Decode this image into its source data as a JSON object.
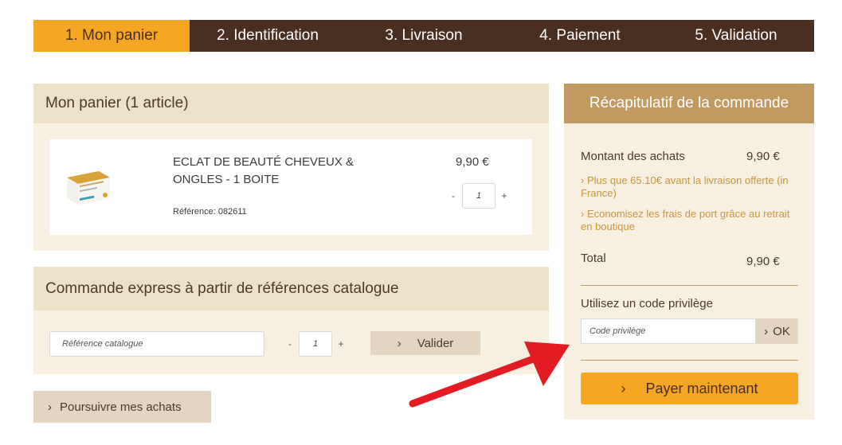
{
  "steps": [
    {
      "label": "1. Mon panier"
    },
    {
      "label": "2. Identification"
    },
    {
      "label": "3. Livraison"
    },
    {
      "label": "4. Paiement"
    },
    {
      "label": "5. Validation"
    }
  ],
  "cart": {
    "title": "Mon panier (1 article)",
    "item": {
      "name": "ECLAT DE BEAUTÉ CHEVEUX & ONGLES - 1 BOITE",
      "reference": "Référence: 082611",
      "price": "9,90 €",
      "quantity": "1",
      "minus": "-",
      "plus": "+"
    }
  },
  "express": {
    "title": "Commande express à partir de références catalogue",
    "ref_placeholder": "Référence catalogue",
    "quantity": "1",
    "minus": "-",
    "plus": "+",
    "validate_label": "Valider"
  },
  "continue_label": "Poursuivre mes achats",
  "summary": {
    "title": "Récapitulatif de la commande",
    "purchases_label": "Montant des achats",
    "purchases_value": "9,90 €",
    "free_shipping_info": "Plus que 65.10€ avant la livraison offerte (in France)",
    "store_pickup_info": "Economisez les frais de port grâce au retrait en boutique",
    "total_label": "Total",
    "total_value": "9,90 €",
    "code_label": "Utilisez un code privilège",
    "code_placeholder": "Code privilège",
    "ok_label": "OK",
    "pay_label": "Payer maintenant"
  },
  "chevron": "›",
  "colors": {
    "brown": "#4a2e1f",
    "orange": "#f5a623",
    "tan": "#c19a62",
    "beige_light": "#f7efdf",
    "beige": "#ede1c8",
    "arrow_red": "#e31b23"
  },
  "icons": [
    "chevron-right-icon",
    "red-arrow-annotation"
  ]
}
